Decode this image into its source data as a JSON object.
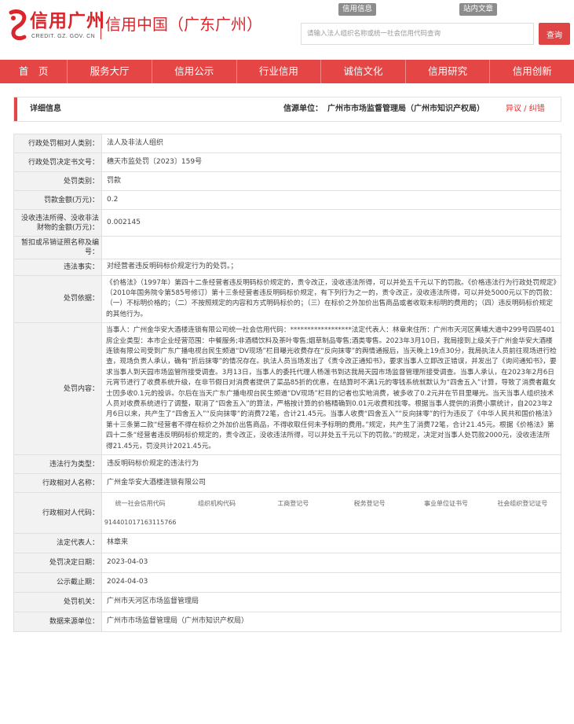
{
  "header": {
    "logo_text": "信用广州",
    "logo_sub": "CREDIT. GZ. GOV. CN",
    "site_title": "信用中国（广东广州）",
    "top_links": [
      "信用信息",
      "站内文章"
    ],
    "search_placeholder": "请输入法人组织名称或统一社会信用代码查询",
    "search_button": "查询"
  },
  "nav": [
    "首　页",
    "服务大厅",
    "信用公示",
    "行业信用",
    "诚信文化",
    "信用研究",
    "信用创新"
  ],
  "detail": {
    "title": "详细信息",
    "source_label": "信源单位：",
    "source_unit": "广州市市场监督管理局（广州市知识产权局）",
    "feedback": "异议 / 纠错"
  },
  "rows": {
    "subject_type": {
      "label": "行政处罚相对人类别：",
      "value": "法人及非法人组织"
    },
    "decision_no": {
      "label": "行政处罚决定书文号：",
      "value": "穗天市监处罚〔2023〕159号"
    },
    "penalty_type": {
      "label": "处罚类别：",
      "value": "罚款"
    },
    "fine_amount": {
      "label": "罚款金额(万元)：",
      "value": "0.2"
    },
    "confiscated_amount": {
      "label": "没收违法所得、没收非法财物的金额(万元)：",
      "value": "0.002145"
    },
    "suspend_license": {
      "label": "暂扣或吊销证照名称及编号：",
      "value": ""
    },
    "violation_facts": {
      "label": "违法事实：",
      "value": "对经营者违反明码标价规定行为的处罚。；"
    },
    "penalty_basis": {
      "label": "处罚依据：",
      "value": "《价格法》（1997年）第四十二条经营者违反明码标价规定的，责令改正，没收违法所得，可以并处五千元以下的罚款。《价格违法行为行政处罚规定》（2010年国务院令第585号修订）第十三条经营者违反明码标价规定，有下列行为之一的，责令改正，没收违法所得，可以并处5000元以下的罚款：（一）不标明价格的；（二）不按照规定的内容和方式明码标价的；（三）在标价之外加价出售商品或者收取未标明的费用的；（四）违反明码标价规定的其他行为。"
    },
    "penalty_content": {
      "label": "处罚内容：",
      "value": "当事人：广州金华安大酒楼连锁有限公司统一社会信用代码：******************法定代表人：林章来住所：广州市天河区黄埔大道中299号四层401房企业类型：本市企业经营范围：中餐服务;非酒精饮料及茶叶零售;烟草制品零售;酒类零售。2023年3月10日，我局接到上级关于广州金华安大酒楼连锁有限公司受到广东广播电视台民生频道“DV现场”栏目曝光收费存在“反向抹零”的舆情通报后，当天晚上19点30分，我局执法人员前往现场进行检查，现场负责人承认，确有“折后抹零”的情况存在。执法人员当场发出了《责令改正通知书》，要求当事人立即改正错误，并发出了《询问通知书》，要求当事人到天园市场监管所接受调查。3月13日，当事人的委托代理人杨莲书到达我局天园市场监督管理所接受调查。当事人承认，在2023年2月6日元宵节进行了收费系统升级，在非节假日对消费者提供了菜品85折的优惠，在结算时不满1元的零钱系统就默认为“四舍五入”计算，导致了消费者戴女士因多收0.1元的投诉。尔后在当天广东广播电视台民生频道“DV现场”栏目的记者也实地消费，被多收了0.2元并在节目里曝光。当天当事人组织技术人员对收费系统进行了调整，取消了“四舍五入”的算法，严格按计算的价格精确到0.01元收费和找零。根据当事人提供的消费小票统计，自2023年2月6日以来，共产生了“四舍五入”“反向抹零”的消费72笔，合计21.45元。当事人收费“四舍五入”“反向抹零”的行为违反了《中华人民共和国价格法》第十三条第二款“经营者不得在标价之外加价出售商品，不得收取任何未予标明的费用。”规定，共产生了消费72笔，合计21.45元。根据《价格法》第四十二条“经营者违反明码标价规定的，责令改正，没收违法所得，可以并处五千元以下的罚款。”的规定，决定对当事人处罚款2000元，没收违法所得21.45元，罚没共计2021.45元。"
    },
    "violation_type": {
      "label": "违法行为类型：",
      "value": "违反明码标价规定的违法行为"
    },
    "counterparty_name": {
      "label": "行政相对人名称：",
      "value": "广州金华安大酒楼连锁有限公司"
    },
    "counterparty_code": {
      "label": "行政相对人代码：",
      "headers": [
        "统一社会信用代码",
        "组织机构代码",
        "工商登记号",
        "税务登记号",
        "事业单位证书号",
        "社会组织登记证号"
      ],
      "values": [
        "914401017163115766",
        "",
        "",
        "",
        "",
        ""
      ]
    },
    "legal_rep": {
      "label": "法定代表人：",
      "value": "林章来"
    },
    "decision_date": {
      "label": "处罚决定日期：",
      "value": "2023-04-03"
    },
    "publish_deadline": {
      "label": "公示截止期：",
      "value": "2024-04-03"
    },
    "authority": {
      "label": "处罚机关：",
      "value": "广州市天河区市场监督管理局"
    },
    "data_source_unit": {
      "label": "数据来源单位：",
      "value": "广州市市场监督管理局（广州市知识产权局）"
    }
  },
  "colors": {
    "brand_red": "#e64545",
    "logo_red": "#d9262c",
    "label_bg": "#f2f2f2",
    "border": "#e0e0e0"
  }
}
